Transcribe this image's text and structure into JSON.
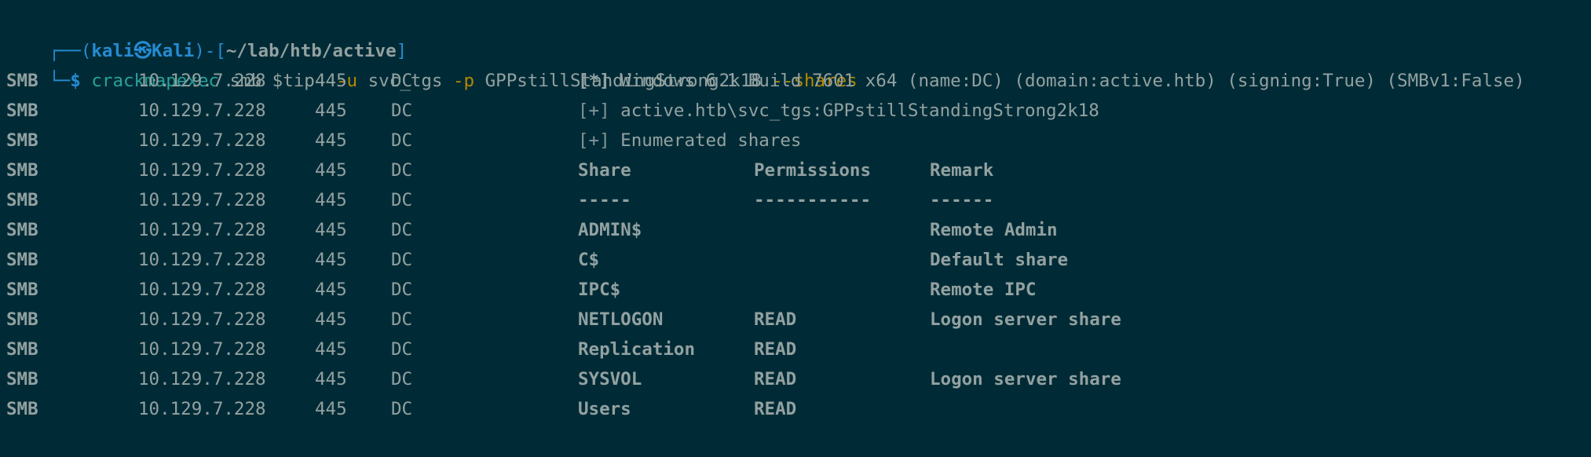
{
  "prompt": {
    "corner_top": "┌──(",
    "user": "kali㉿",
    "host": "Kali",
    "close_paren": ")-[",
    "path": "~/lab/htb/active",
    "close_bracket": "]",
    "corner_bottom": "└─",
    "dollar": "$ ",
    "command": "crackmapexec",
    "args1": " smb $tip  ",
    "flag_u": "-u",
    "user_arg": " svc_tgs ",
    "flag_p": "-p",
    "pass_arg": " GPPstillStandingStrong2k18 ",
    "flag_shares": "--shares"
  },
  "rows": [
    {
      "proto": "SMB",
      "ip": "10.129.7.228",
      "port": "445",
      "host": "DC",
      "tag": "[*]",
      "msg": " Windows 6.1 Build 7601 x64 (name:DC) (domain:active.htb) (signing:True) (SMBv1:False)"
    },
    {
      "proto": "SMB",
      "ip": "10.129.7.228",
      "port": "445",
      "host": "DC",
      "tag": "[+]",
      "msg": " active.htb\\svc_tgs:GPPstillStandingStrong2k18"
    },
    {
      "proto": "SMB",
      "ip": "10.129.7.228",
      "port": "445",
      "host": "DC",
      "tag": "[+]",
      "msg": " Enumerated shares"
    }
  ],
  "share_rows": [
    {
      "proto": "SMB",
      "ip": "10.129.7.228",
      "port": "445",
      "host": "DC",
      "share": "Share",
      "perm": "Permissions",
      "remark": "Remark"
    },
    {
      "proto": "SMB",
      "ip": "10.129.7.228",
      "port": "445",
      "host": "DC",
      "share": "-----",
      "perm": "-----------",
      "remark": "------"
    },
    {
      "proto": "SMB",
      "ip": "10.129.7.228",
      "port": "445",
      "host": "DC",
      "share": "ADMIN$",
      "perm": "",
      "remark": "Remote Admin"
    },
    {
      "proto": "SMB",
      "ip": "10.129.7.228",
      "port": "445",
      "host": "DC",
      "share": "C$",
      "perm": "",
      "remark": "Default share"
    },
    {
      "proto": "SMB",
      "ip": "10.129.7.228",
      "port": "445",
      "host": "DC",
      "share": "IPC$",
      "perm": "",
      "remark": "Remote IPC"
    },
    {
      "proto": "SMB",
      "ip": "10.129.7.228",
      "port": "445",
      "host": "DC",
      "share": "NETLOGON",
      "perm": "READ",
      "remark": "Logon server share"
    },
    {
      "proto": "SMB",
      "ip": "10.129.7.228",
      "port": "445",
      "host": "DC",
      "share": "Replication",
      "perm": "READ",
      "remark": ""
    },
    {
      "proto": "SMB",
      "ip": "10.129.7.228",
      "port": "445",
      "host": "DC",
      "share": "SYSVOL",
      "perm": "READ",
      "remark": "Logon server share"
    },
    {
      "proto": "SMB",
      "ip": "10.129.7.228",
      "port": "445",
      "host": "DC",
      "share": "Users",
      "perm": "READ",
      "remark": ""
    }
  ],
  "colors": {
    "background": "#002b36",
    "text": "#93a1a1",
    "prompt_frame": "#268bd2",
    "path": "#b58900",
    "command": "#2aa198",
    "flags": "#859900"
  }
}
